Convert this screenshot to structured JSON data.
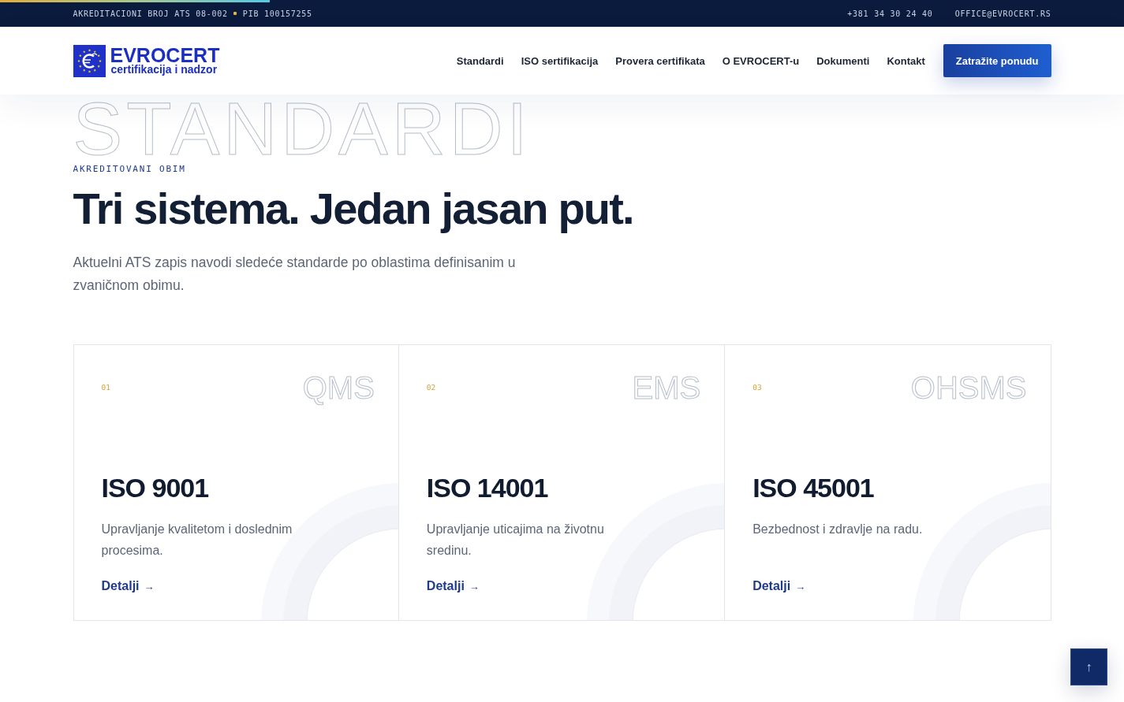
{
  "top_bar": {
    "scroll_progress": {
      "level": 0.24
    },
    "accreditation": "AKREDITACIONI BROJ ATS 08-002",
    "tax_id": "PIB 100157255",
    "phone": "+381 34 30 24 40",
    "email": "OFFICE@EVROCERT.RS"
  },
  "header": {
    "logo": {
      "name": "EVROCERT",
      "tagline": "certifikacija i nadzor"
    },
    "nav": [
      "Standardi",
      "ISO sertifikacija",
      "Provera certifikata",
      "O EVROCERT-u",
      "Dokumenti",
      "Kontakt"
    ],
    "cta": "Zatražite ponudu"
  },
  "hero": {
    "backdrop_text": "STANDARDI",
    "eyebrow": "AKREDITOVANI OBIM",
    "title": "Tri sistema. Jedan jasan put.",
    "lead": "Aktuelni ATS zapis navodi sledeće standarde po oblastima definisanim u zvaničnom obimu."
  },
  "cards": [
    {
      "number": "01",
      "code": "QMS",
      "title": "ISO 9001",
      "description": "Upravljanje kvalitetom i doslednim procesima.",
      "link": "Detalji",
      "link_arrow": "→"
    },
    {
      "number": "02",
      "code": "EMS",
      "title": "ISO 14001",
      "description": "Upravljanje uticajima na životnu sredinu.",
      "link": "Detalji",
      "link_arrow": "→"
    },
    {
      "number": "03",
      "code": "OHSMS",
      "title": "ISO 45001",
      "description": "Bezbednost i zdravlje na radu.",
      "link": "Detalji",
      "link_arrow": "→"
    }
  ],
  "back_to_top": "↑"
}
